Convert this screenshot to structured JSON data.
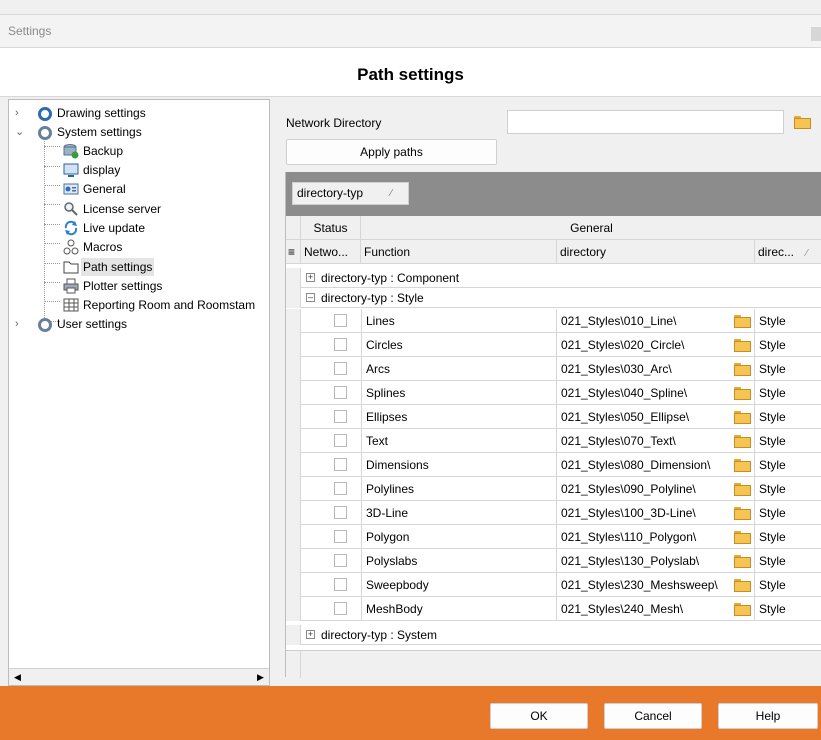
{
  "window": {
    "title": "Settings"
  },
  "page": {
    "heading": "Path settings"
  },
  "tree": [
    {
      "label": "Drawing settings",
      "expanded": false,
      "icon": "gear-blue-icon"
    },
    {
      "label": "System settings",
      "expanded": true,
      "icon": "gear-icon"
    },
    {
      "label": "Backup",
      "icon": "backup-icon"
    },
    {
      "label": "display",
      "icon": "monitor-icon"
    },
    {
      "label": "General",
      "icon": "general-icon"
    },
    {
      "label": "License server",
      "icon": "magnifier-icon"
    },
    {
      "label": "Live update",
      "icon": "refresh-icon"
    },
    {
      "label": "Macros",
      "icon": "macros-icon"
    },
    {
      "label": "Path settings",
      "icon": "folder-icon",
      "selected": true
    },
    {
      "label": "Plotter settings",
      "icon": "printer-icon"
    },
    {
      "label": "Reporting Room and Roomstam",
      "icon": "table-icon"
    },
    {
      "label": "User settings",
      "expanded": false,
      "icon": "gear-icon"
    }
  ],
  "network": {
    "label": "Network Directory",
    "value": ""
  },
  "buttons": {
    "apply": "Apply paths",
    "ok": "OK",
    "cancel": "Cancel",
    "help": "Help"
  },
  "grid": {
    "group_chip": "directory-typ",
    "header_status": "Status",
    "header_general": "General",
    "col_network": "Netwo...",
    "col_function": "Function",
    "col_directory": "directory",
    "col_dirtype": "direc...",
    "groups": [
      {
        "label": "directory-typ : Component",
        "expanded": false
      },
      {
        "label": "directory-typ : Style",
        "expanded": true
      },
      {
        "label": "directory-typ : System",
        "expanded": false
      }
    ],
    "rows": [
      {
        "function": "Lines",
        "directory": "021_Styles\\010_Line\\",
        "type": "Style"
      },
      {
        "function": "Circles",
        "directory": "021_Styles\\020_Circle\\",
        "type": "Style"
      },
      {
        "function": "Arcs",
        "directory": "021_Styles\\030_Arc\\",
        "type": "Style"
      },
      {
        "function": "Splines",
        "directory": "021_Styles\\040_Spline\\",
        "type": "Style"
      },
      {
        "function": "Ellipses",
        "directory": "021_Styles\\050_Ellipse\\",
        "type": "Style"
      },
      {
        "function": "Text",
        "directory": "021_Styles\\070_Text\\",
        "type": "Style"
      },
      {
        "function": "Dimensions",
        "directory": "021_Styles\\080_Dimension\\",
        "type": "Style"
      },
      {
        "function": "Polylines",
        "directory": "021_Styles\\090_Polyline\\",
        "type": "Style"
      },
      {
        "function": "3D-Line",
        "directory": "021_Styles\\100_3D-Line\\",
        "type": "Style"
      },
      {
        "function": "Polygon",
        "directory": "021_Styles\\110_Polygon\\",
        "type": "Style"
      },
      {
        "function": "Polyslabs",
        "directory": "021_Styles\\130_Polyslab\\",
        "type": "Style"
      },
      {
        "function": "Sweepbody",
        "directory": "021_Styles\\230_Meshsweep\\",
        "type": "Style"
      },
      {
        "function": "MeshBody",
        "directory": "021_Styles\\240_Mesh\\",
        "type": "Style"
      }
    ]
  }
}
